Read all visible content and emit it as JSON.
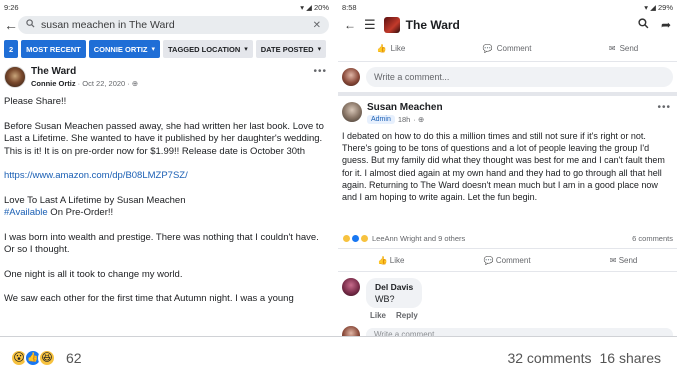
{
  "left": {
    "status_time": "9:26",
    "status_right": "20%",
    "search_query": "susan meachen in The Ward",
    "filters": [
      {
        "label": "2",
        "style": "blue"
      },
      {
        "label": "MOST RECENT",
        "style": "blue"
      },
      {
        "label": "CONNIE ORTIZ",
        "style": "blue",
        "caret": "▾"
      },
      {
        "label": "TAGGED LOCATION",
        "style": "grey",
        "caret": "▾"
      },
      {
        "label": "DATE POSTED",
        "style": "grey",
        "caret": "▾"
      }
    ],
    "post": {
      "group": "The Ward",
      "author": "Connie Ortiz",
      "date": "Oct 22, 2020",
      "paragraphs": [
        "Please Share!!",
        "Before Susan Meachen passed away, she had written her last book. Love to Last a Lifetime. She wanted to have it published by her daughter's wedding.  This is it! It is on pre-order now for $1.99!! Release date is October 30th",
        "https://www.amazon.com/dp/B08LMZP7SZ/",
        "Love To Last A Lifetime by Susan Meachen",
        "I was born into wealth and prestige. There was nothing that I couldn't have. Or so I thought.",
        "One night is all it took to change my world.",
        "We saw each other for the first time that Autumn night. I was a young"
      ],
      "hashtag": "#Available",
      "hashtag_suffix": " On Pre-Order!!"
    }
  },
  "right": {
    "status_time": "8:58",
    "status_right": "29%",
    "group_name": "The Ward",
    "top_actions": {
      "like": "Like",
      "comment": "Comment",
      "send": "Send"
    },
    "write_comment": "Write a comment...",
    "post": {
      "author": "Susan Meachen",
      "badge": "Admin",
      "age": "18h",
      "body": "I debated on how to do this a million times and still not sure if it's right or not. There's going to be tons of questions and a lot of people leaving the group I'd guess. But my family did what they thought was best for me and I can't fault them for it. I almost died again at my own hand and they had to go through all that hell again. Returning to The Ward doesn't mean much but I am in a good place now and I am hoping to write again. Let the fun begin.",
      "reactors": "LeeAnn Wright and 9 others",
      "comments_count": "6 comments",
      "actions": {
        "like": "Like",
        "comment": "Comment",
        "send": "Send"
      }
    },
    "comment": {
      "author": "Del Davis",
      "text": "WB?",
      "like": "Like",
      "reply": "Reply"
    },
    "write_comment2": "Write a comment..."
  },
  "footer": {
    "reaction_count": "62",
    "comments": "32 comments",
    "shares": "16 shares"
  },
  "colors": {
    "accent": "#1877f2",
    "chip_blue": "#1f6ed6",
    "link": "#1a5fb4"
  }
}
